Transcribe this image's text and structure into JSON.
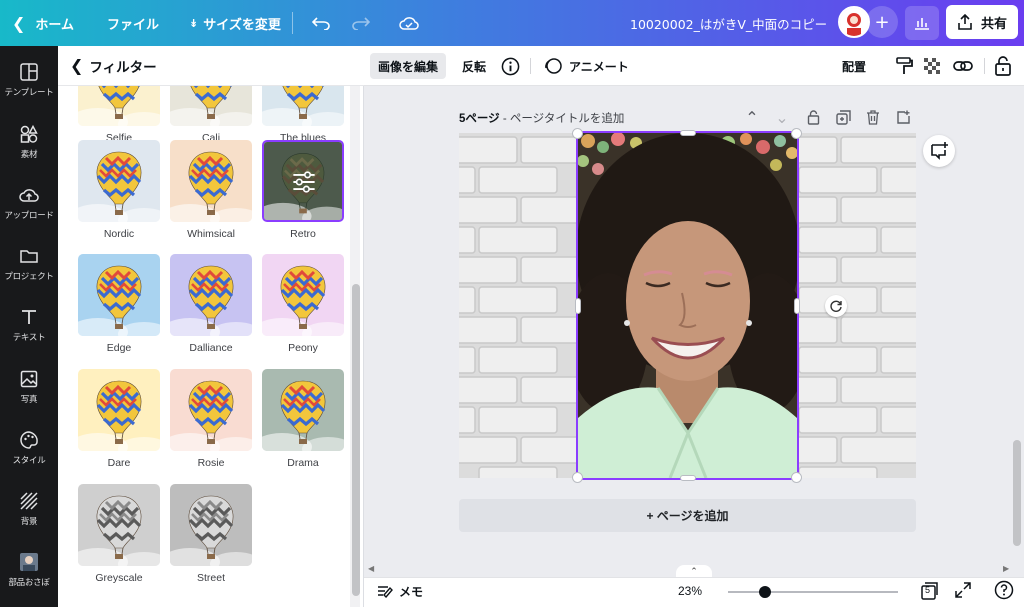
{
  "topbar": {
    "home": "ホーム",
    "file": "ファイル",
    "resize": "サイズを変更",
    "doc_title": "10020002_はがきV_中面のコピー",
    "share": "共有"
  },
  "rail": [
    {
      "label": "テンプレート",
      "icon": "template-icon"
    },
    {
      "label": "素材",
      "icon": "elements-icon"
    },
    {
      "label": "アップロード",
      "icon": "upload-icon"
    },
    {
      "label": "プロジェクト",
      "icon": "folder-icon"
    },
    {
      "label": "テキスト",
      "icon": "text-icon"
    },
    {
      "label": "写真",
      "icon": "photo-icon"
    },
    {
      "label": "スタイル",
      "icon": "palette-icon"
    },
    {
      "label": "背景",
      "icon": "background-icon"
    },
    {
      "label": "部品おさぼ",
      "icon": "app-thumbnail-icon"
    }
  ],
  "panel": {
    "title": "フィルター",
    "filters": [
      {
        "name": "Selfie",
        "tint": "#fbf1cf"
      },
      {
        "name": "Cali",
        "tint": "#e7e5da"
      },
      {
        "name": "The blues",
        "tint": "#d9e6ee"
      },
      {
        "name": "Nordic",
        "tint": "#dfe7ef"
      },
      {
        "name": "Whimsical",
        "tint": "#f7dfc9"
      },
      {
        "name": "Retro",
        "tint": "#4d5a4c"
      },
      {
        "name": "Edge",
        "tint": "#a9d3f0"
      },
      {
        "name": "Dalliance",
        "tint": "#c7c3f2"
      },
      {
        "name": "Peony",
        "tint": "#f1d6f3"
      },
      {
        "name": "Dare",
        "tint": "#fff0bf"
      },
      {
        "name": "Rosie",
        "tint": "#f9dcd2"
      },
      {
        "name": "Drama",
        "tint": "#a9bab0"
      },
      {
        "name": "Greyscale",
        "tint": "#cfcfcf"
      },
      {
        "name": "Street",
        "tint": "#bdbdbd"
      }
    ],
    "selected": "Retro"
  },
  "toolbar": {
    "edit_image": "画像を編集",
    "flip": "反転",
    "animate": "アニメート",
    "arrange": "配置"
  },
  "page": {
    "number_label": "5ページ",
    "title_placeholder": " - ページタイトルを追加",
    "add_page": "+ ページを追加",
    "page_count": "5"
  },
  "bottom": {
    "notes": "メモ",
    "zoom": "23%"
  },
  "colors": {
    "accent": "#8b3dff",
    "topbar_start": "#18b9c9",
    "topbar_end": "#6a3df0"
  }
}
